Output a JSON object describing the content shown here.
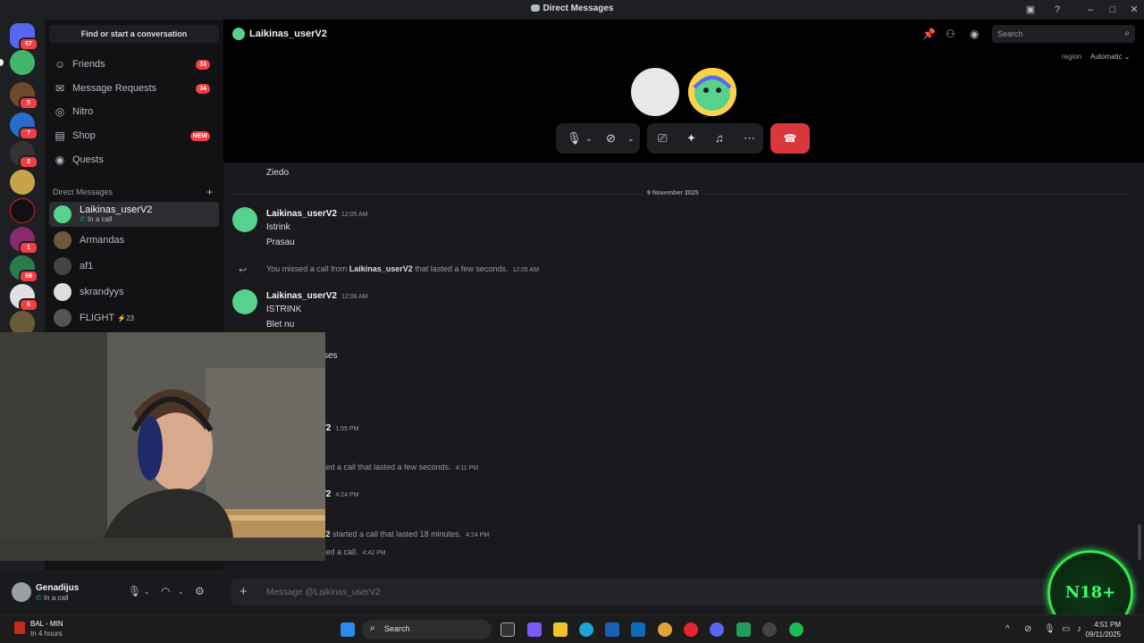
{
  "window": {
    "title": "Direct Messages"
  },
  "servers": {
    "badges": [
      "67",
      "5",
      "7",
      "2",
      "1",
      "69",
      "6"
    ]
  },
  "sidebar": {
    "find_label": "Find or start a conversation",
    "nav": [
      {
        "label": "Friends",
        "count": "33",
        "icon": "friends-icon"
      },
      {
        "label": "Message Requests",
        "count": "34",
        "icon": "mail-icon"
      },
      {
        "label": "Nitro",
        "count": "",
        "icon": "nitro-icon"
      },
      {
        "label": "Shop",
        "count": "NEW",
        "icon": "shop-icon"
      },
      {
        "label": "Quests",
        "count": "",
        "icon": "quests-icon"
      }
    ],
    "dm_header": "Direct Messages",
    "dms": [
      {
        "name": "Laikinas_userV2",
        "status": "In a call",
        "active": true
      },
      {
        "name": "Armandas",
        "status": "",
        "active": false
      },
      {
        "name": "af1",
        "status": "",
        "active": false
      },
      {
        "name": "skrandyys",
        "status": "",
        "active": false
      },
      {
        "name": "FLIGHT",
        "status": "",
        "boost": "23",
        "active": false
      }
    ]
  },
  "user_panel": {
    "name": "Genadijus",
    "status": "In a call"
  },
  "header": {
    "channel_name": "Laikinas_userV2",
    "search_placeholder": "Search",
    "region_label": "region",
    "region_value": "Automatic"
  },
  "messages": {
    "top_fragment": "Ziedo",
    "date_divider": "9 November 2025",
    "groups": [
      {
        "author": "Laikinas_userV2",
        "time": "12:05 AM",
        "lines": [
          "Istrink",
          "Prasau"
        ]
      },
      {
        "author": "Laikinas_userV2",
        "time": "12:06 AM",
        "lines": [
          "ISTRINK",
          "Blet nu"
        ]
      }
    ],
    "missed_call": {
      "prefix": "You missed a call from",
      "name": "Laikinas_userV2",
      "suffix": "that lasted a few seconds.",
      "time": "12:05 AM"
    },
    "partial": [
      {
        "text": "ses",
        "time": ""
      },
      {
        "text": "/2",
        "time": "1:55 PM"
      },
      {
        "text": "ted a call that lasted a few seconds.",
        "time": "4:11 PM"
      },
      {
        "text": "/2",
        "time": "4:24 PM"
      },
      {
        "text": "started a call that lasted 18 minutes.",
        "prefix": "/2",
        "time": "4:24 PM"
      },
      {
        "text": "ted a call.",
        "time": "4:42 PM"
      }
    ],
    "composer_placeholder": "Message @Laikinas_userV2"
  },
  "overlay": {
    "badge_text": "N18+"
  },
  "taskbar": {
    "weather_line1": "BAL - MIN",
    "weather_line2": "In 4 hours",
    "search_label": "Search",
    "time": "4:51 PM",
    "date": "09/11/2025",
    "notification_count": "1"
  },
  "colors": {
    "accent_green": "#2eea4c",
    "danger": "#da373c",
    "badge": "#f23f43",
    "background": "#1a1a1e",
    "sidebar": "#121214"
  }
}
